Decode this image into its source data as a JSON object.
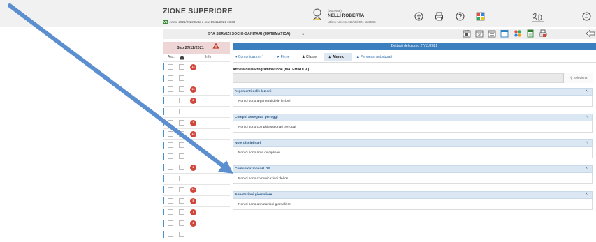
{
  "header": {
    "school_name": "ZIONE SUPERIORE",
    "year_badge": "V1",
    "year_text": "Anno: 2021/2022  Data e ora: 19/11/2021 18:38",
    "user_role": "(Docente)",
    "user_name": "NELLI ROBERTA",
    "last_access": "Ultimo Accesso: 19/11/2021 11.35.55"
  },
  "classbar": {
    "class_label": "5^A SERVIZI SOCIO-SANITARI (MATEMATICA)",
    "calendar_day": "26"
  },
  "left_panel": {
    "date_label": "Sab 27/11/2021",
    "col_ass": "Ass.",
    "col_info": "Info",
    "rows": [
      {
        "badge": "14"
      },
      {
        "badge": ""
      },
      {
        "badge": "15"
      },
      {
        "badge": "8"
      },
      {
        "badge": ""
      },
      {
        "badge": "2"
      },
      {
        "badge": "13"
      },
      {
        "badge": ""
      },
      {
        "badge": ""
      },
      {
        "badge": "3"
      },
      {
        "badge": ""
      },
      {
        "badge": "16"
      },
      {
        "badge": "5"
      },
      {
        "badge": "7"
      },
      {
        "badge": "4"
      },
      {
        "badge": ""
      }
    ]
  },
  "main": {
    "detail_title": "Dettagli del giorno 27/11/2021",
    "tabs": [
      {
        "label": "Comunicazioni *",
        "icon": "megaphone-icon"
      },
      {
        "label": "Firme",
        "icon": "signature-icon"
      },
      {
        "label": "Classe",
        "icon": "group-icon"
      },
      {
        "label": "Alunno",
        "icon": "person-icon"
      },
      {
        "label": "Permessi autorizzati",
        "icon": "people-icon"
      }
    ],
    "programmazione_title": "Attività dalla Programmazione (MATEMATICA)",
    "select_label": "Seleziona",
    "sections": [
      {
        "title": "Argomenti delle lezioni",
        "body": "Non ci sono argomenti delle lezioni"
      },
      {
        "title": "Compiti assegnati per oggi",
        "body": "Non ci sono compiti assegnati per oggi"
      },
      {
        "title": "Note disciplinari",
        "body": "Non ci sono note disciplinari"
      },
      {
        "title": "Comunicazioni del DS",
        "body": "Non ci sono comunicazioni del ds"
      },
      {
        "title": "Annotazioni giornaliere",
        "body": "Non ci sono annotazioni giornaliere"
      }
    ]
  },
  "colors": {
    "accent_blue": "#3b7fbf",
    "section_header": "#dbe7f3",
    "alert_red": "#d0463b",
    "annotation_arrow": "#5b8fcf"
  }
}
